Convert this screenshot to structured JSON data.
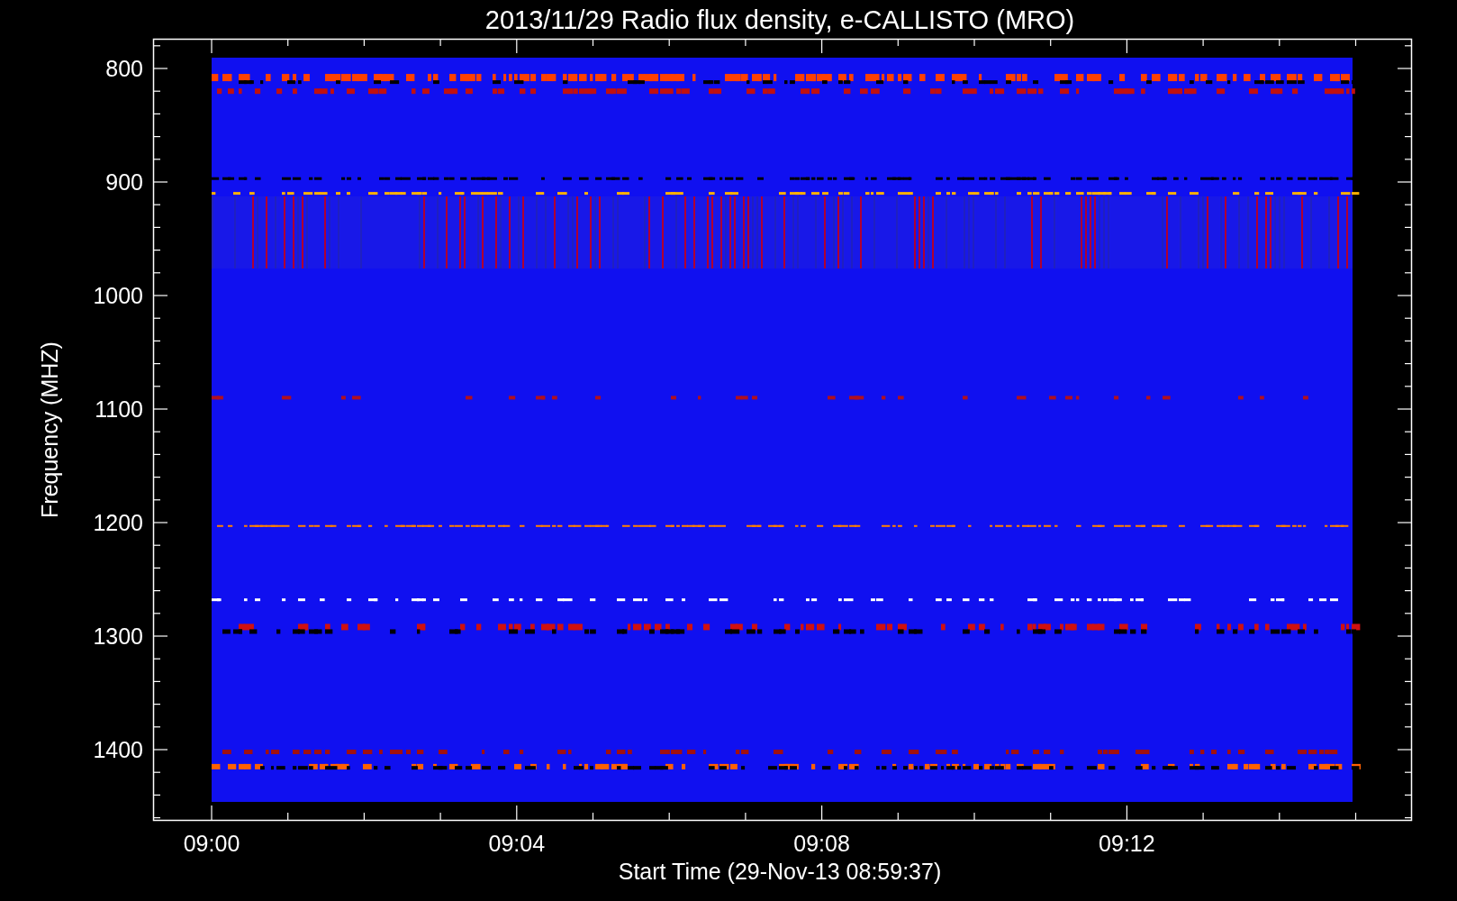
{
  "title": "2013/11/29  Radio flux density, e-CALLISTO (MRO)",
  "y_axis": {
    "label": "Frequency (MHZ)",
    "ticks": [
      "800",
      "900",
      "1000",
      "1100",
      "1200",
      "1300",
      "1400"
    ]
  },
  "x_axis": {
    "label": "Start Time (29-Nov-13 08:59:37)",
    "ticks": [
      "09:00",
      "09:04",
      "09:08",
      "09:12"
    ]
  }
}
